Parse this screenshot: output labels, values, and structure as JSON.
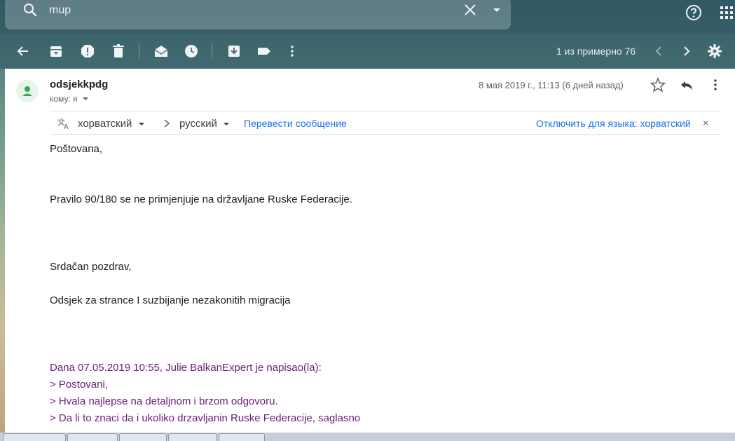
{
  "search": {
    "value": "mup"
  },
  "toolbar": {
    "pager_text": "1 из примерно 76"
  },
  "message": {
    "sender": "odsjekkpdg",
    "to_label": "кому: я",
    "date": "8 мая 2019 г., 11:13 (6 дней назад)"
  },
  "translate": {
    "from_lang": "хорватский",
    "to_lang": "русский",
    "translate_link": "Перевести сообщение",
    "disable_link": "Отключить для языка: хорватский",
    "close_symbol": "×"
  },
  "body": {
    "greeting": "Poštovana,",
    "line1": "Pravilo 90/180 se ne primjenjuje na državljane Ruske Federacije.",
    "closing": "Srdačan pozdrav,",
    "signature": "Odsjek za strance I suzbijanje nezakonitih migracija"
  },
  "quote": {
    "header": "Dana 07.05.2019 10:55, Julie BalkanExpert je napisao(la):",
    "lines": [
      "> Postovani,",
      "> Hvala najlepse na detaljnom i brzom odgovoru.",
      "> Da li to znaci da i ukoliko drzavljanin Ruske Federacije, saglasno"
    ]
  },
  "colors": {
    "link": "#1a73e8",
    "quote": "#6b1e7a",
    "avatar_bg": "#e6f4ea",
    "avatar_fg": "#34a853"
  }
}
